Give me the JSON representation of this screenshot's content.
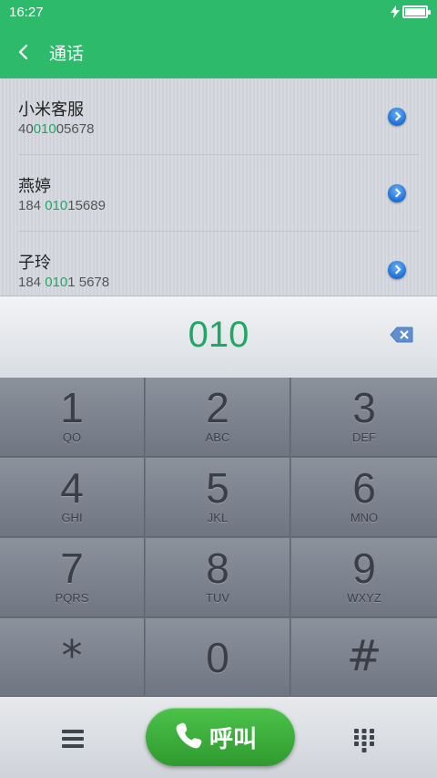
{
  "status_bar": {
    "time": "16:27",
    "battery": "full",
    "charging": true
  },
  "header": {
    "title": "通话",
    "back_icon": "chevron-left-icon"
  },
  "results": [
    {
      "name": "小米客服",
      "number_pre": "40",
      "number_hl": "010",
      "number_post": "05678"
    },
    {
      "name": "燕婷",
      "number_pre": "184 ",
      "number_hl": "010",
      "number_post": "15689"
    },
    {
      "name": "子玲",
      "number_pre": "184 ",
      "number_hl": "010",
      "number_post": "1 5678"
    }
  ],
  "display": {
    "digits": "010"
  },
  "keypad": [
    {
      "num": "1",
      "letters": "QO"
    },
    {
      "num": "2",
      "letters": "ABC"
    },
    {
      "num": "3",
      "letters": "DEF"
    },
    {
      "num": "4",
      "letters": "GHI"
    },
    {
      "num": "5",
      "letters": "JKL"
    },
    {
      "num": "6",
      "letters": "MNO"
    },
    {
      "num": "7",
      "letters": "PQRS"
    },
    {
      "num": "8",
      "letters": "TUV"
    },
    {
      "num": "9",
      "letters": "WXYZ"
    },
    {
      "num": "*",
      "letters": ""
    },
    {
      "num": "0",
      "letters": ""
    },
    {
      "num": "#",
      "letters": ""
    }
  ],
  "bottom_bar": {
    "call_label": "呼叫",
    "menu_icon": "menu-icon",
    "keypad_icon": "keypad-icon"
  },
  "colors": {
    "accent": "#2dbb6b",
    "highlight": "#20a862",
    "call_button": "#3aab3a"
  }
}
